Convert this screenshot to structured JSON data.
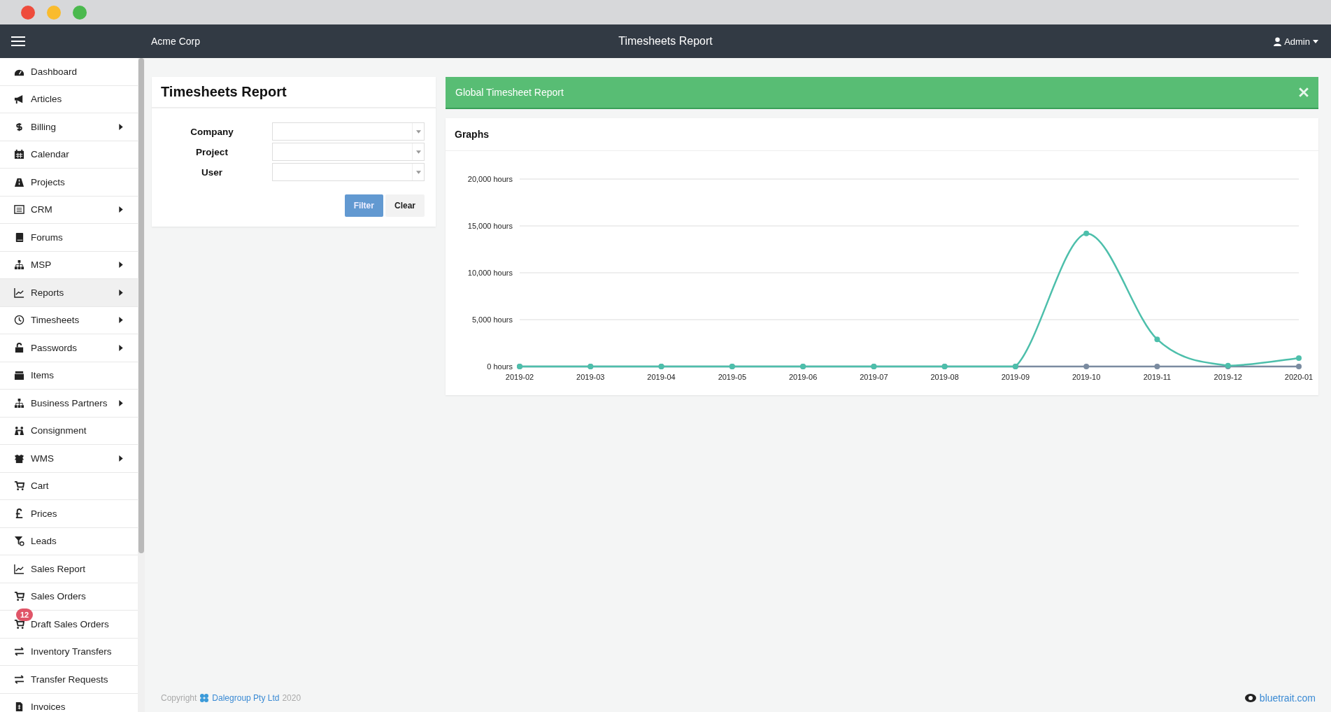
{
  "navbar": {
    "brand": "Acme Corp",
    "title": "Timesheets Report",
    "user": "Admin"
  },
  "sidebar": {
    "items": [
      {
        "label": "Dashboard",
        "has_submenu": false,
        "selected": false
      },
      {
        "label": "Articles",
        "has_submenu": false,
        "selected": false
      },
      {
        "label": "Billing",
        "has_submenu": true,
        "selected": false
      },
      {
        "label": "Calendar",
        "has_submenu": false,
        "selected": false
      },
      {
        "label": "Projects",
        "has_submenu": false,
        "selected": false
      },
      {
        "label": "CRM",
        "has_submenu": true,
        "selected": false
      },
      {
        "label": "Forums",
        "has_submenu": false,
        "selected": false
      },
      {
        "label": "MSP",
        "has_submenu": true,
        "selected": false
      },
      {
        "label": "Reports",
        "has_submenu": true,
        "selected": true
      },
      {
        "label": "Timesheets",
        "has_submenu": true,
        "selected": false
      },
      {
        "label": "Passwords",
        "has_submenu": true,
        "selected": false
      },
      {
        "label": "Items",
        "has_submenu": false,
        "selected": false
      },
      {
        "label": "Business Partners",
        "has_submenu": true,
        "selected": false
      },
      {
        "label": "Consignment",
        "has_submenu": false,
        "selected": false
      },
      {
        "label": "WMS",
        "has_submenu": true,
        "selected": false
      },
      {
        "label": "Cart",
        "has_submenu": false,
        "selected": false
      },
      {
        "label": "Prices",
        "has_submenu": false,
        "selected": false
      },
      {
        "label": "Leads",
        "has_submenu": false,
        "selected": false
      },
      {
        "label": "Sales Report",
        "has_submenu": false,
        "selected": false
      },
      {
        "label": "Sales Orders",
        "has_submenu": false,
        "selected": false
      },
      {
        "label": "Draft Sales Orders",
        "has_submenu": false,
        "selected": false,
        "badge": "12"
      },
      {
        "label": "Inventory Transfers",
        "has_submenu": false,
        "selected": false
      },
      {
        "label": "Transfer Requests",
        "has_submenu": false,
        "selected": false
      },
      {
        "label": "Invoices",
        "has_submenu": false,
        "selected": false
      }
    ]
  },
  "filter_card": {
    "title": "Timesheets Report",
    "fields": [
      {
        "label": "Company"
      },
      {
        "label": "Project"
      },
      {
        "label": "User"
      }
    ],
    "buttons": [
      {
        "label": "Filter",
        "kind": "primary"
      },
      {
        "label": "Clear",
        "kind": "default"
      }
    ]
  },
  "alert": {
    "text": "Global Timesheet Report"
  },
  "graphs_card": {
    "title": "Graphs",
    "chart_data": {
      "type": "line",
      "categories": [
        "2019-02",
        "2019-03",
        "2019-04",
        "2019-05",
        "2019-06",
        "2019-07",
        "2019-08",
        "2019-09",
        "2019-10",
        "2019-11",
        "2019-12",
        "2020-01"
      ],
      "series": [
        {
          "color": "#7a8ba0",
          "marker": true,
          "values": [
            0,
            0,
            0,
            0,
            0,
            0,
            0,
            0,
            0,
            0,
            0,
            0
          ]
        },
        {
          "color": "#4dbfab",
          "marker": true,
          "values": [
            0,
            0,
            0,
            0,
            0,
            0,
            0,
            0,
            14200,
            2900,
            100,
            900
          ]
        }
      ],
      "grid": true,
      "ylim": [
        0,
        20000
      ],
      "yticks": [
        {
          "value": 0,
          "label": "0 hours"
        },
        {
          "value": 5000,
          "label": "5,000 hours"
        },
        {
          "value": 10000,
          "label": "10,000 hours"
        },
        {
          "value": 15000,
          "label": "15,000 hours"
        },
        {
          "value": 20000,
          "label": "20,000 hours"
        }
      ]
    }
  },
  "footer": {
    "copyright": "Copyright",
    "company": "Dalegroup Pty Ltd",
    "year": "2020",
    "site": "bluetrait.com"
  }
}
